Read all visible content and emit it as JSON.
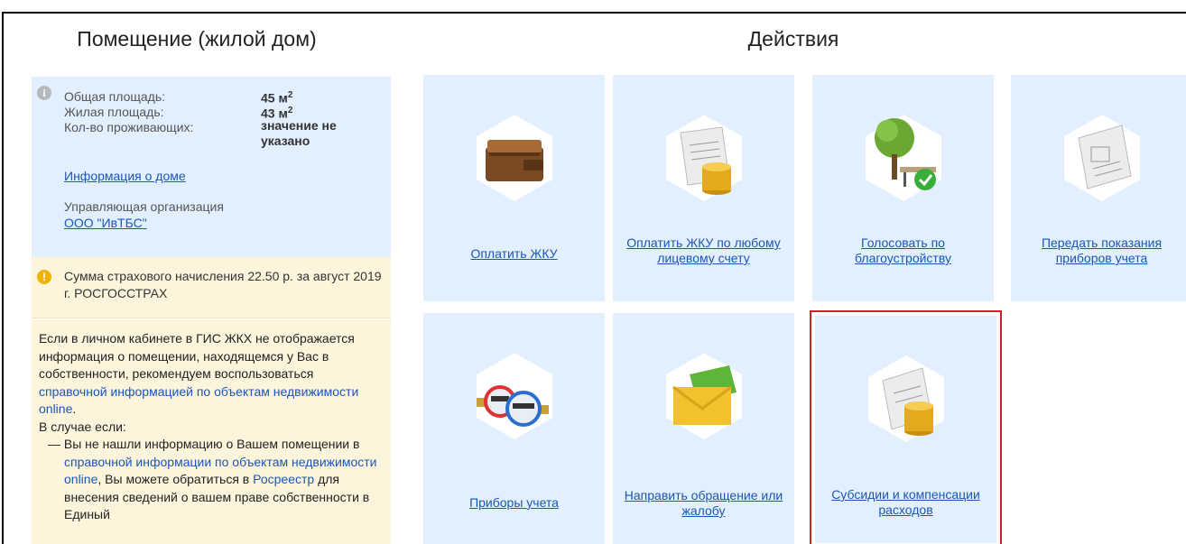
{
  "left": {
    "title": "Помещение (жилой дом)",
    "info": {
      "total_area_label": "Общая площадь:",
      "total_area_value": "45 м",
      "living_area_label": "Жилая площадь:",
      "living_area_value": "43 м",
      "residents_label": "Кол-во проживающих:",
      "residents_value": "значение не указано",
      "house_info_link": "Информация о доме",
      "management_label": "Управляющая организация",
      "management_link": "ООО \"ИвТБС\""
    },
    "warning": "Сумма страхового начисления 22.50 р. за август 2019 г. РОСГОССТРАХ",
    "note": {
      "p1_a": "Если в личном кабинете в ГИС ЖКХ не отображается информация о помещении, находящемся у Вас в собственности, рекомендуем воспользоваться ",
      "p1_link": "справочной информацией по объектам недвижимости online",
      "p1_b": ".",
      "p2": "В случае если:",
      "item_a": "— Вы не нашли информацию о Вашем помещении в ",
      "item_link1": "справочной информации по объектам недвижимости online",
      "item_b": ", Вы можете обратиться в ",
      "item_link2": "Росреестр",
      "item_c": " для внесения сведений о вашем праве собственности в Единый"
    }
  },
  "right": {
    "title": "Действия",
    "tiles": [
      {
        "label": "Оплатить ЖКУ",
        "icon": "wallet-icon"
      },
      {
        "label": "Оплатить ЖКУ по любому лицевому счету",
        "icon": "account-coins-icon"
      },
      {
        "label": "Голосовать по благоустройству",
        "icon": "tree-bench-icon"
      },
      {
        "label": "Передать показания приборов учета",
        "icon": "meter-readings-icon"
      },
      {
        "label": "Приборы учета",
        "icon": "water-meters-icon"
      },
      {
        "label": "Направить обращение или жалобу",
        "icon": "envelope-icon"
      },
      {
        "label": "Субсидии и компенсации расходов",
        "icon": "subsidies-coins-icon"
      }
    ]
  },
  "colors": {
    "accent": "#1a56b8",
    "tile_bg": "#e2efff",
    "warn_bg": "#fdf4dc",
    "highlight": "#d0202a"
  }
}
